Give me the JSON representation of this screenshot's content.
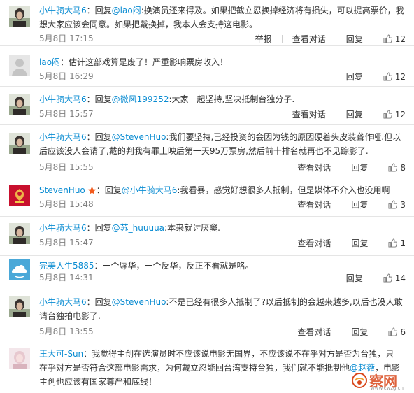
{
  "comments": [
    {
      "user": "小牛骑大马6",
      "avatar": "avatar-a",
      "parts": [
        {
          "t": "：回复"
        },
        {
          "t": "@lao闷",
          "at": true
        },
        {
          "t": ":换演员还来得及。如果把截立忍换掉经济将有损失，可以提高票价，我想大家应该会同意。如果把戴换掉，我本人会支持这电影。"
        }
      ],
      "time": "5月8日 17:15",
      "report": "举报",
      "view": "查看对话",
      "reply": "回复",
      "likes": "12"
    },
    {
      "user": "lao闷",
      "avatar": "avatar-default",
      "parts": [
        {
          "t": "：估计这部戏算是废了！严重影响票房收入！"
        }
      ],
      "time": "5月8日 16:29",
      "reply": "回复",
      "likes": "12"
    },
    {
      "user": "小牛骑大马6",
      "avatar": "avatar-a",
      "parts": [
        {
          "t": "：回复"
        },
        {
          "t": "@微风199252",
          "at": true
        },
        {
          "t": ":大家一起坚持,坚决抵制台独分子."
        }
      ],
      "time": "5月8日 15:57",
      "view": "查看对话",
      "reply": "回复",
      "likes": "12"
    },
    {
      "user": "小牛骑大马6",
      "avatar": "avatar-a",
      "parts": [
        {
          "t": "：回复"
        },
        {
          "t": "@StevenHuo",
          "at": true
        },
        {
          "t": ":我们要坚持,已经投资的会因为钱的原因硬着头皮装聋作哑.但以后应该没人会请了,戴的判我有罪上映后第一天95万票房,然后前十排名就再也不见踪影了."
        }
      ],
      "time": "5月8日 15:55",
      "view": "查看对话",
      "reply": "回复",
      "likes": "8"
    },
    {
      "user": "StevenHuo",
      "avatar": "avatar-liverpool",
      "badge": "star",
      "parts": [
        {
          "t": "：回复"
        },
        {
          "t": "@小牛骑大马6",
          "at": true
        },
        {
          "t": ":我看暴，感觉好想很多人抵制，但是媒体不介入也没用啊"
        }
      ],
      "time": "5月8日 15:48",
      "view": "查看对话",
      "reply": "回复",
      "likes": "3"
    },
    {
      "user": "小牛骑大马6",
      "avatar": "avatar-a",
      "parts": [
        {
          "t": "：回复"
        },
        {
          "t": "@苏_huuuua",
          "at": true
        },
        {
          "t": ":本来就讨厌窦."
        }
      ],
      "time": "5月8日 15:47",
      "view": "查看对话",
      "reply": "回复",
      "likes": "1"
    },
    {
      "user": "完美人生5885",
      "avatar": "avatar-cloud",
      "parts": [
        {
          "t": "：一个辱华，一个反华，反正不看就是咯。"
        }
      ],
      "time": "5月8日 14:31",
      "reply": "回复",
      "likes": "14"
    },
    {
      "user": "小牛骑大马6",
      "avatar": "avatar-a",
      "parts": [
        {
          "t": "：回复"
        },
        {
          "t": "@StevenHuo",
          "at": true
        },
        {
          "t": ":不是已经有很多人抵制了?以后抵制的会越来越多,以后也没人敢请台独拍电影了."
        }
      ],
      "time": "5月8日 13:55",
      "view": "查看对话",
      "reply": "回复",
      "likes": "6"
    },
    {
      "user": "王大可-Sun",
      "avatar": "avatar-pink",
      "parts": [
        {
          "t": "：我觉得主创在选演员时不应该说电影无国界，不应该说不在乎对方是否为台独，只在乎对方是否符合这部电影需求，为何戴立忍能回台湾支持台独，我们就不能抵制他"
        },
        {
          "t": "@赵薇",
          "at": true
        },
        {
          "t": "，电影主创也应该有国家尊严和底线！"
        }
      ]
    }
  ],
  "watermark": {
    "text": "察网",
    "sub": "www.cwzg.cn"
  }
}
